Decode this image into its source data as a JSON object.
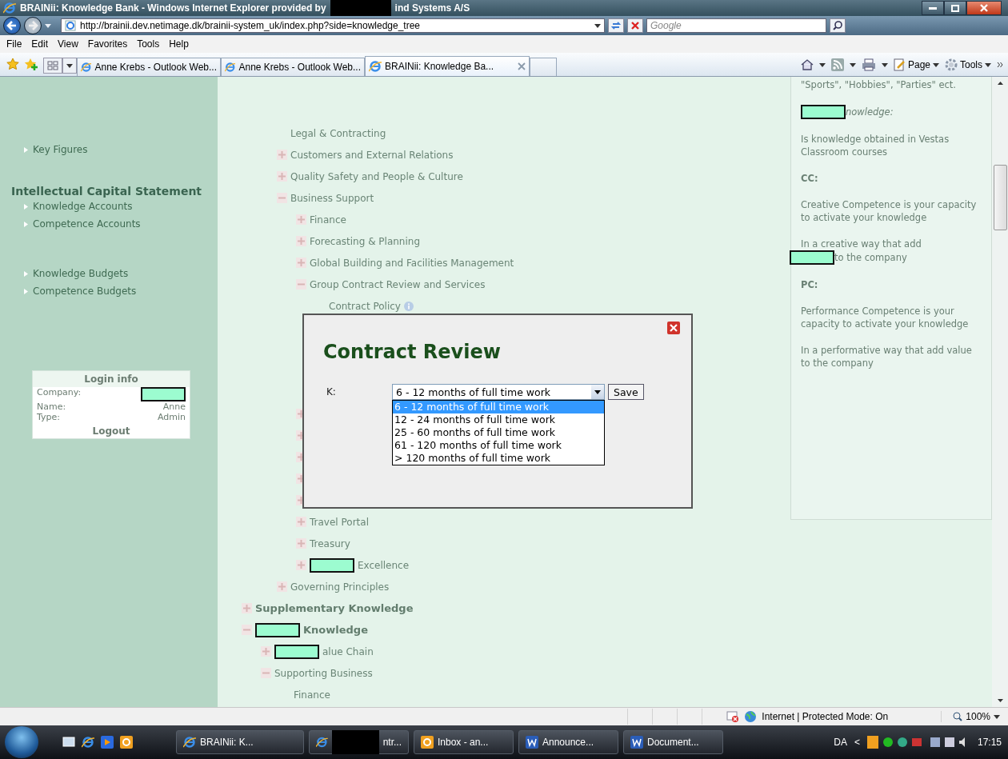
{
  "window": {
    "title": "BRAINii: Knowledge Bank - Windows Internet Explorer provided by",
    "title_redacted": true,
    "title_after": "ind Systems A/S"
  },
  "address_bar": {
    "url": "http://brainii.dev.netimage.dk/brainii-system_uk/index.php?side=knowledge_tree",
    "search_placeholder": "Google"
  },
  "menu": [
    "File",
    "Edit",
    "View",
    "Favorites",
    "Tools",
    "Help"
  ],
  "tabs": [
    {
      "label": "Anne Krebs - Outlook Web...",
      "selected": false
    },
    {
      "label": "Anne Krebs - Outlook Web...",
      "selected": false
    },
    {
      "label": "BRAINii: Knowledge Ba...",
      "selected": true
    }
  ],
  "command_bar": [
    "Page",
    "Tools"
  ],
  "sidebar": {
    "items": [
      {
        "kind": "link",
        "label": "Key Figures"
      },
      {
        "kind": "heading",
        "label": "Intellectual Capital Statement"
      },
      {
        "kind": "link",
        "label": "Knowledge Accounts"
      },
      {
        "kind": "link",
        "label": "Competence Accounts"
      },
      {
        "kind": "spacer"
      },
      {
        "kind": "link",
        "label": "Knowledge Budgets"
      },
      {
        "kind": "link",
        "label": "Competence Budgets"
      }
    ],
    "login": {
      "title": "Login info",
      "rows": [
        {
          "label": "Company:",
          "redacted": true
        },
        {
          "label": "Name:",
          "value": "Anne"
        },
        {
          "label": "Type:",
          "value": "Admin"
        }
      ],
      "logout": "Logout"
    }
  },
  "tree": {
    "scrolled_branch": [
      {
        "kind": "leaf",
        "label": "Legal & Contracting"
      },
      {
        "kind": "branch",
        "expanded": false,
        "label": "Customers and External Relations"
      },
      {
        "kind": "branch",
        "expanded": false,
        "label": "Quality Safety and People & Culture"
      },
      {
        "kind": "branch",
        "expanded": true,
        "label": "Business Support",
        "children": [
          {
            "kind": "branch",
            "expanded": false,
            "label": "Finance"
          },
          {
            "kind": "branch",
            "expanded": false,
            "label": "Forecasting & Planning"
          },
          {
            "kind": "branch",
            "expanded": false,
            "label": "Global Building and Facilities Management"
          },
          {
            "kind": "branch",
            "expanded": true,
            "label": "Group Contract Review and Services",
            "children": [
              {
                "kind": "leaf",
                "label": "Contract Policy",
                "info": true
              }
            ]
          },
          {
            "kind": "branch",
            "expanded": false
          },
          {
            "kind": "branch",
            "expanded": false
          },
          {
            "kind": "branch",
            "expanded": false
          },
          {
            "kind": "branch",
            "expanded": false
          },
          {
            "kind": "branch",
            "expanded": false
          },
          {
            "kind": "branch",
            "expanded": false,
            "label": "Travel Portal"
          },
          {
            "kind": "branch",
            "expanded": false,
            "label": "Treasury"
          },
          {
            "kind": "branch",
            "expanded": false,
            "label": "Excellence",
            "redacted": true
          }
        ]
      },
      {
        "kind": "branch",
        "expanded": false,
        "label": "Governing Principles"
      }
    ],
    "items": [
      {
        "kind": "branch",
        "expanded": false,
        "label": "Supplementary Knowledge"
      },
      {
        "kind": "branch",
        "expanded": true,
        "label": "Knowledge",
        "redacted": true,
        "children": [
          {
            "kind": "branch",
            "expanded": false,
            "label": "alue Chain",
            "redacted": true
          },
          {
            "kind": "branch",
            "expanded": true,
            "label": "Supporting Business",
            "children": [
              {
                "kind": "leaf",
                "label": "Finance"
              }
            ]
          }
        ]
      }
    ]
  },
  "info_panel": [
    {
      "kind": "text",
      "text": "\"Sports\", \"Hobbies\", \"Parties\" ect."
    },
    {
      "kind": "italic",
      "text": "nowledge:",
      "redacted": true
    },
    {
      "kind": "text",
      "text": "Is knowledge obtained in Vestas Classroom courses"
    },
    {
      "kind": "heading",
      "text": "CC:"
    },
    {
      "kind": "text",
      "text": "Creative Competence is your capacity to activate your knowledge"
    },
    {
      "kind": "text",
      "text": "In a creative way that add",
      "redacted": true,
      "after": "to the company"
    },
    {
      "kind": "heading",
      "text": "PC:"
    },
    {
      "kind": "text",
      "text": "Performance Competence is your capacity to activate your knowledge"
    },
    {
      "kind": "text",
      "text": "In a performative way that add value to the company"
    }
  ],
  "dialog": {
    "title": "Contract Review",
    "field_label": "K:",
    "value": "6 - 12 months of full time work",
    "expanded": true,
    "options": [
      {
        "label": "6 - 12 months of full time work",
        "selected": true
      },
      {
        "label": "12 - 24 months of full time work",
        "selected": false
      },
      {
        "label": "25 - 60 months of full time work",
        "selected": false
      },
      {
        "label": "61 - 120 months of full time work",
        "selected": false
      },
      {
        "label": "> 120 months of full time work",
        "selected": false
      }
    ],
    "save": "Save"
  },
  "status_bar": {
    "zone": "Internet | Protected Mode: On",
    "zoom": "100%"
  },
  "taskbar": {
    "buttons": [
      {
        "label": "BRAINii: K...",
        "kind": "browser"
      },
      {
        "label": "ntr...",
        "kind": "browser",
        "redacted": true
      },
      {
        "label": "Inbox - an...",
        "kind": "mail"
      },
      {
        "label": "Announce...",
        "kind": "document"
      },
      {
        "label": "Document...",
        "kind": "document"
      }
    ],
    "language": "DA",
    "tray_expand": "<",
    "time": "17:15"
  }
}
